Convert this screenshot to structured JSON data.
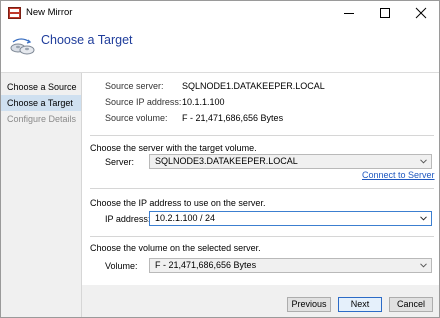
{
  "window": {
    "title": "New Mirror"
  },
  "header": {
    "title": "Choose a Target"
  },
  "sidebar": {
    "items": [
      {
        "label": "Choose a Source"
      },
      {
        "label": "Choose a Target"
      },
      {
        "label": "Configure Details"
      }
    ]
  },
  "source": {
    "server_label": "Source server:",
    "server_value": "SQLNODE1.DATAKEEPER.LOCAL",
    "ip_label": "Source IP address:",
    "ip_value": "10.1.1.100",
    "volume_label": "Source volume:",
    "volume_value": "F - 21,471,686,656 Bytes"
  },
  "target_server": {
    "prompt": "Choose the server with the target volume.",
    "label": "Server:",
    "value": "SQLNODE3.DATAKEEPER.LOCAL",
    "link": "Connect to Server"
  },
  "ip": {
    "prompt": "Choose the IP address to use on the server.",
    "label": "IP address:",
    "value": "10.2.1.100 / 24"
  },
  "volume": {
    "prompt": "Choose the volume on the selected server.",
    "label": "Volume:",
    "value": "F - 21,471,686,656 Bytes"
  },
  "buttons": {
    "previous": "Previous",
    "next": "Next",
    "cancel": "Cancel"
  },
  "colors": {
    "accent": "#1f3d9b",
    "link": "#1f58c0",
    "selected_nav": "#cfe0f0"
  }
}
